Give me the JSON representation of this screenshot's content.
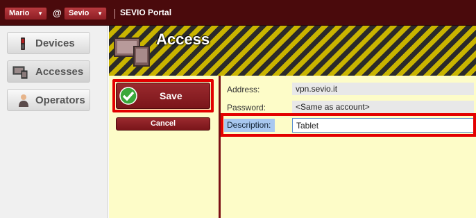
{
  "topbar": {
    "user_label": "Mario",
    "at": "@",
    "company_label": "Sevio",
    "portal_title": "SEVIO Portal"
  },
  "nav": {
    "items": [
      {
        "label": "Devices",
        "icon": "phone-icon"
      },
      {
        "label": "Accesses",
        "icon": "devices-icon"
      },
      {
        "label": "Operators",
        "icon": "person-icon"
      }
    ]
  },
  "header": {
    "title": "Access",
    "icon": "devices-icon"
  },
  "actions": {
    "save_label": "Save",
    "cancel_label": "Cancel"
  },
  "form": {
    "address_label": "Address:",
    "address_value": "vpn.sevio.it",
    "password_label": "Password:",
    "password_value": "<Same as account>",
    "description_label": "Description:",
    "description_value": "Tablet"
  },
  "colors": {
    "topbar": "#4a0a0c",
    "button": "#8e1f25",
    "highlight": "#e30000",
    "panel": "#fdfcc8",
    "stripe_dark": "#2a2a2a",
    "stripe_yellow": "#c9b400"
  }
}
